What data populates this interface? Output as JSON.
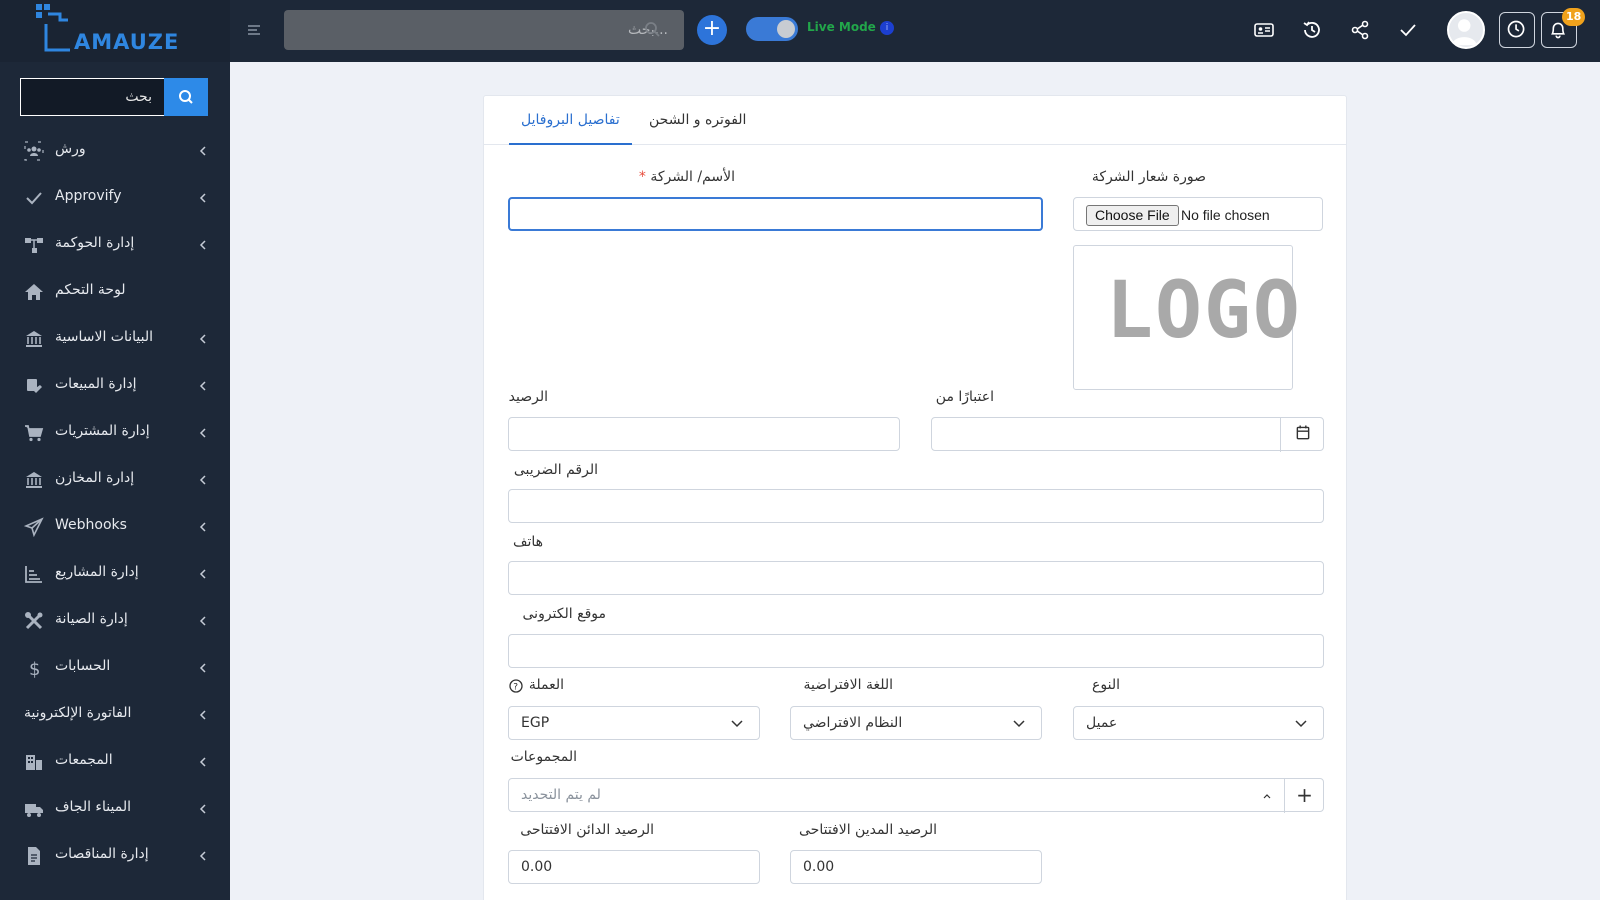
{
  "app": {
    "brand_name": "AMAUZE",
    "search_placeholder": "...بحث",
    "live_mode_label": "Live Mode",
    "notifications_count": "18"
  },
  "sidebar": {
    "search_placeholder": "بحث",
    "items": [
      {
        "label": "ورش",
        "icon": "workers-icon",
        "has_chevron": true
      },
      {
        "label": "Approvify",
        "icon": "check-icon",
        "has_chevron": true
      },
      {
        "label": "إدارة الحوكمة",
        "icon": "hierarchy-icon",
        "has_chevron": true
      },
      {
        "label": "لوحة التحكم",
        "icon": "home-icon",
        "has_chevron": false
      },
      {
        "label": "البيانات الاساسية",
        "icon": "bank-icon",
        "has_chevron": true
      },
      {
        "label": "إدارة المبيعات",
        "icon": "sales-icon",
        "has_chevron": true
      },
      {
        "label": "إدارة المشتريات",
        "icon": "cart-icon",
        "has_chevron": true
      },
      {
        "label": "إدارة المخازن",
        "icon": "warehouse-icon",
        "has_chevron": true
      },
      {
        "label": "Webhooks",
        "icon": "send-icon",
        "has_chevron": true
      },
      {
        "label": "إدارة المشاريع",
        "icon": "chart-icon",
        "has_chevron": true
      },
      {
        "label": "إدارة الصيانة",
        "icon": "tools-icon",
        "has_chevron": true
      },
      {
        "label": "الحسابات",
        "icon": "dollar-icon",
        "has_chevron": true
      },
      {
        "label": "الفاتورة الإلكترونية",
        "icon": "",
        "has_chevron": true
      },
      {
        "label": "المجمعات",
        "icon": "building-icon",
        "has_chevron": true
      },
      {
        "label": "الميناء الجاف",
        "icon": "truck-icon",
        "has_chevron": true
      },
      {
        "label": "إدارة المناقصات",
        "icon": "document-icon",
        "has_chevron": true
      }
    ]
  },
  "form": {
    "tabs": [
      {
        "label": "تفاصيل البروفايل",
        "active": true
      },
      {
        "label": "الفوتره و الشحن",
        "active": false
      }
    ],
    "logo_label": "صورة شعار الشركة",
    "choose_file_label": "Choose File",
    "no_file_label": "No file chosen",
    "logo_placeholder_text": "LOGO",
    "name_label": "الأسم/ الشركة",
    "required_mark": "*",
    "name_value": "",
    "from_date_label": "اعتبارًا من",
    "from_date_value": "",
    "balance_label": "الرصيد",
    "balance_value": "",
    "tax_number_label": "الرقم الضريبى",
    "tax_number_value": "",
    "phone_label": "هاتف",
    "phone_value": "",
    "website_label": "موقع الكترونى",
    "website_value": "",
    "type_label": "النوع",
    "type_value": "عميل",
    "language_label": "اللغة الافتراضية",
    "language_value": "النظام الافتراضي",
    "currency_label": "العملة",
    "currency_value": "EGP",
    "groups_label": "المجموعات",
    "groups_placeholder": "لم يتم التحديد",
    "opening_debit_label": "الرصيد المدين الافتتاحى",
    "opening_debit_value": "0.00",
    "opening_credit_label": "الرصيد الدائن الافتتاحى",
    "opening_credit_value": "0.00"
  }
}
